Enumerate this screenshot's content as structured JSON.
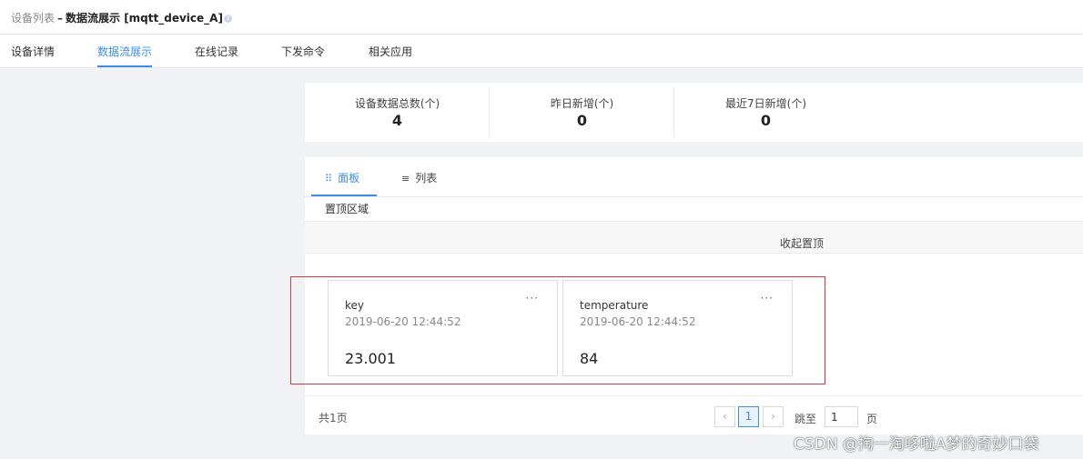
{
  "breadcrumb": {
    "root": "设备列表",
    "separator": "–",
    "current": "数据流展示 [mqtt_device_A]",
    "help_icon": "question-circle-icon"
  },
  "tabs": [
    {
      "label": "设备详情",
      "active": false
    },
    {
      "label": "数据流展示",
      "active": true
    },
    {
      "label": "在线记录",
      "active": false
    },
    {
      "label": "下发命令",
      "active": false
    },
    {
      "label": "相关应用",
      "active": false
    }
  ],
  "stats": [
    {
      "label": "设备数据总数(个)",
      "value": "4"
    },
    {
      "label": "昨日新增(个)",
      "value": "0"
    },
    {
      "label": "最近7日新增(个)",
      "value": "0"
    }
  ],
  "view_tabs": [
    {
      "label": "面板",
      "icon": "grid-icon",
      "active": true
    },
    {
      "label": "列表",
      "icon": "list-icon",
      "active": false
    }
  ],
  "pinned": {
    "title": "置顶区域",
    "toggle_label": "收起置顶"
  },
  "cards": [
    {
      "name": "key",
      "time": "2019-06-20 12:44:52",
      "value": "23.001",
      "more": "···"
    },
    {
      "name": "temperature",
      "time": "2019-06-20 12:44:52",
      "value": "84",
      "more": "···"
    }
  ],
  "pagination": {
    "total": "共1页",
    "prev": "‹",
    "current": "1",
    "next": "›",
    "jump_label": "跳至",
    "jump_value": "1",
    "jump_suffix": "页"
  },
  "watermark": "CSDN @掏一淘哆啦A梦的奇妙口袋",
  "colors": {
    "accent": "#3b8fe6",
    "highlight": "#d9363e"
  }
}
